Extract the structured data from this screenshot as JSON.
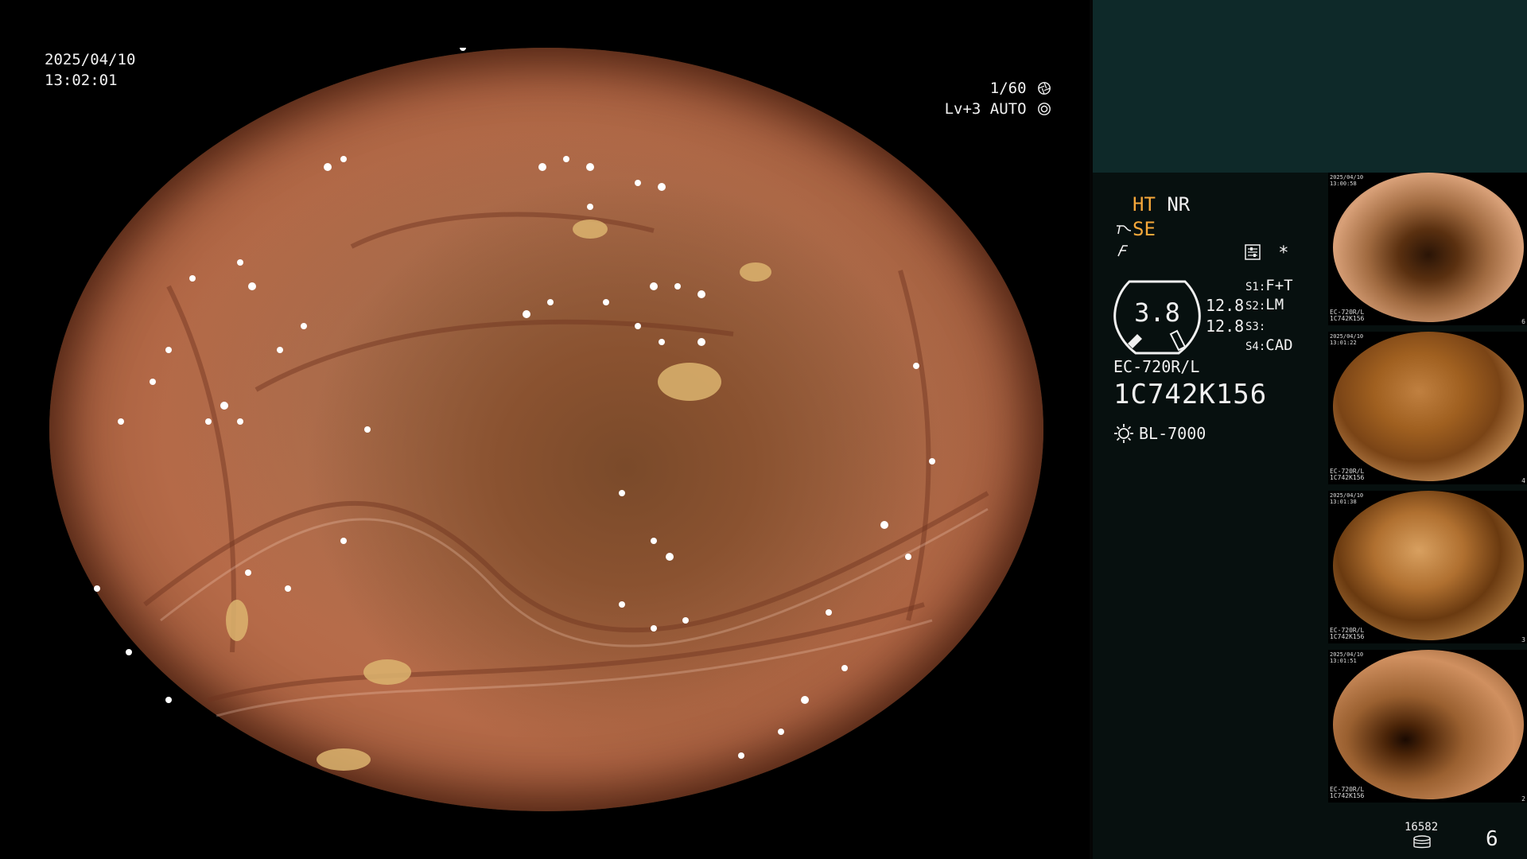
{
  "overlay": {
    "date": "2025/04/10",
    "time": "13:02:01",
    "shutter": "1/60",
    "shutter_icon": "aperture-icon",
    "level": "Lv+3",
    "iris_mode": "AUTO",
    "iris_icon": "iris-icon"
  },
  "panel": {
    "mode_ht": "HT",
    "mode_nr": "NR",
    "mode_se": "SE",
    "se_icon": "enhance-icon",
    "freeze_icon": "freeze-icon",
    "settings_icon": "settings-icon",
    "asterisk": "*",
    "gauge_value": "3.8",
    "gauge_side_1": "12.8",
    "gauge_side_2": "12.8",
    "switches": [
      {
        "key": "S1:",
        "value": "F+T"
      },
      {
        "key": "S2:",
        "value": "LM"
      },
      {
        "key": "S3:",
        "value": ""
      },
      {
        "key": "S4:",
        "value": "CAD"
      }
    ],
    "scope_model": "EC-720R/L",
    "scope_serial": "1C742K156",
    "light_icon": "light-source-icon",
    "light_source": "BL-7000",
    "capture_count": "16582",
    "storage_icon": "database-icon",
    "page_number": "6"
  },
  "thumbnails": [
    {
      "date": "2025/04/10",
      "time": "13:00:58",
      "serial": "1C742K156",
      "model": "EC-720R/L",
      "index": "6"
    },
    {
      "date": "2025/04/10",
      "time": "13:01:22",
      "serial": "1C742K156",
      "model": "EC-720R/L",
      "index": "4"
    },
    {
      "date": "2025/04/10",
      "time": "13:01:38",
      "serial": "1C742K156",
      "model": "EC-720R/L",
      "index": "3"
    },
    {
      "date": "2025/04/10",
      "time": "13:01:51",
      "serial": "1C742K156",
      "model": "EC-720R/L",
      "index": "2"
    }
  ],
  "colors": {
    "accent_orange": "#f7a83a",
    "panel_top": "#0e2929",
    "panel_bg": "#07100f"
  }
}
